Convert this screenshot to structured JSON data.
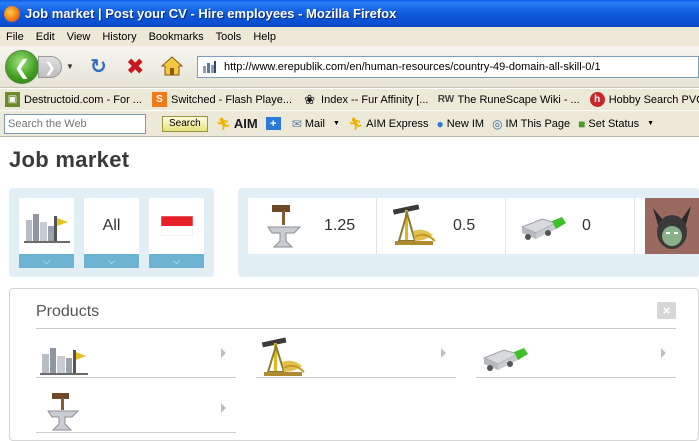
{
  "window": {
    "title": "Job market | Post your CV - Hire employees - Mozilla Firefox"
  },
  "menu": [
    "File",
    "Edit",
    "View",
    "History",
    "Bookmarks",
    "Tools",
    "Help"
  ],
  "nav": {
    "url": "http://www.erepublik.com/en/human-resources/country-49-domain-all-skill-0/1"
  },
  "bookmarks": [
    {
      "label": "Destructoid.com - For ...",
      "icon": "destructoid-icon",
      "color": "#6c8a2a"
    },
    {
      "label": "Switched - Flash Playe...",
      "icon": "switched-icon",
      "color": "#f07a1a"
    },
    {
      "label": "Index -- Fur Affinity [...",
      "icon": "paw-icon",
      "color": "#111111"
    },
    {
      "label": "The RuneScape Wiki - ...",
      "icon": "runescape-wiki-icon",
      "color": "#444444"
    },
    {
      "label": "Hobby Search PVC Fig",
      "icon": "hobby-search-icon",
      "color": "#c8262a"
    }
  ],
  "aim_toolbar": {
    "search_placeholder": "Search the Web",
    "search_label": "Search",
    "aim_label": "AIM",
    "mail_label": "Mail",
    "aim_express_label": "AIM Express",
    "new_im_label": "New IM",
    "im_page_label": "IM This Page",
    "set_status_label": "Set Status"
  },
  "page": {
    "title": "Job market",
    "filters": {
      "skill_label": "All"
    },
    "stats": [
      {
        "icon": "anvil-icon",
        "value": "1.25"
      },
      {
        "icon": "oil-pump-icon",
        "value": "0.5"
      },
      {
        "icon": "truck-icon",
        "value": "0"
      }
    ],
    "products": {
      "title": "Products",
      "close_label": "×",
      "items": [
        {
          "icon": "factory-icon"
        },
        {
          "icon": "oil-pump-icon"
        },
        {
          "icon": "truck-icon"
        },
        {
          "icon": "anvil-icon"
        }
      ]
    }
  },
  "colors": {
    "titlebar": "#0f5bdc",
    "panel_bg": "#e2eef6",
    "arrow_bar": "#6fb3d2",
    "flag_red": "#e8202a"
  }
}
